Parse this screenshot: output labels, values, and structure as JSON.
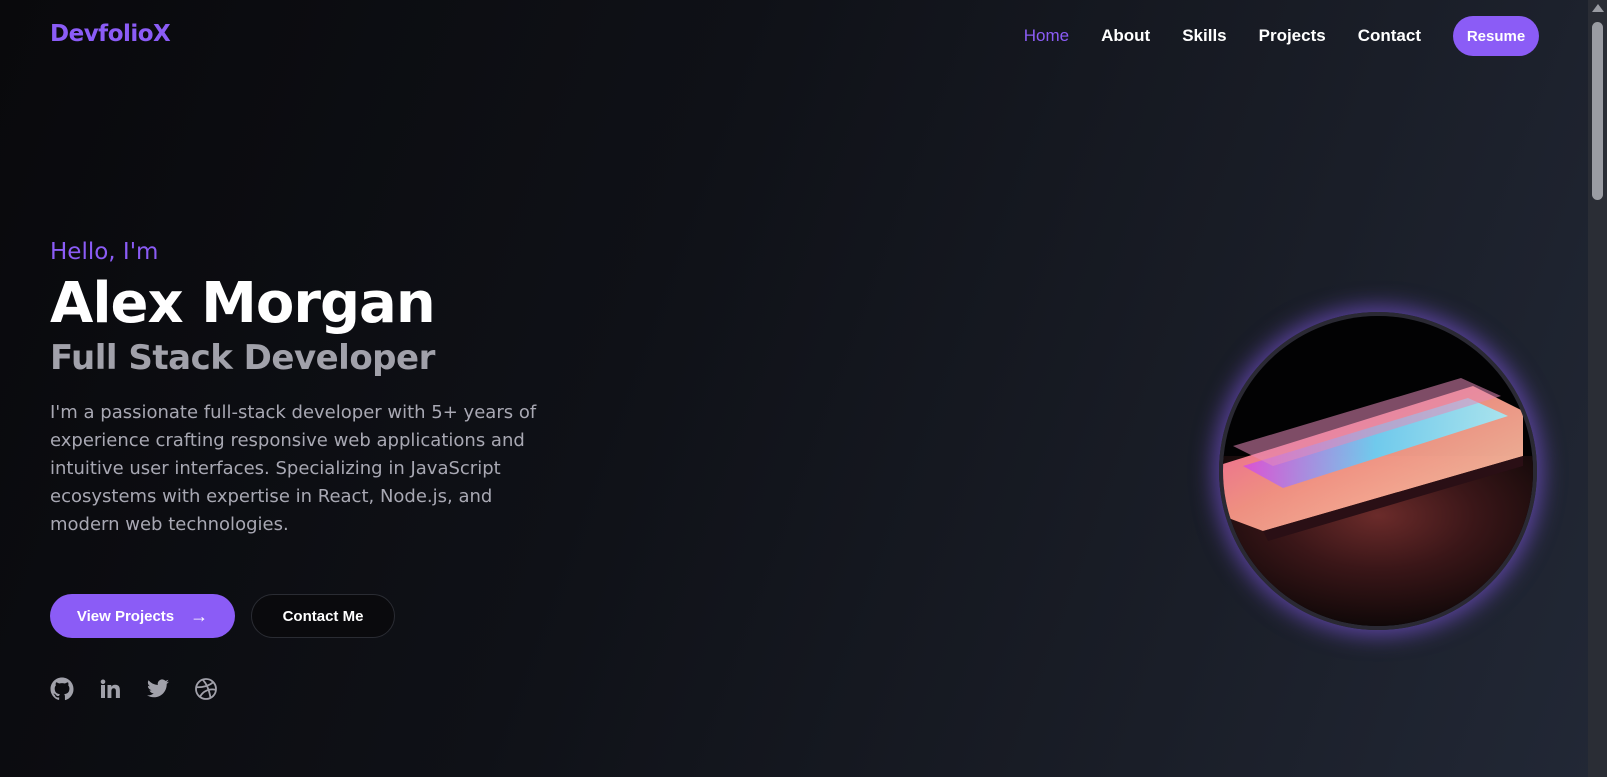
{
  "brand": {
    "logo": "DevfolioX",
    "accent": "#8b5cf6"
  },
  "nav": {
    "links": [
      "Home",
      "About",
      "Skills",
      "Projects",
      "Contact"
    ],
    "active": "Home",
    "resume_label": "Resume"
  },
  "hero": {
    "greeting": "Hello, I'm",
    "name": "Alex Morgan",
    "role": "Full Stack Developer",
    "bio": "I'm a passionate full-stack developer with 5+ years of experience crafting responsive web applications and intuitive user interfaces. Specializing in JavaScript ecosystems with expertise in React, Node.js, and modern web technologies.",
    "primary_cta": "View Projects",
    "primary_cta_icon": "arrow-right-icon",
    "secondary_cta": "Contact Me"
  },
  "socials": [
    {
      "icon": "github-icon"
    },
    {
      "icon": "linkedin-icon"
    },
    {
      "icon": "twitter-icon"
    },
    {
      "icon": "dribbble-icon"
    }
  ],
  "portrait": {
    "subject": "laptop-image"
  }
}
